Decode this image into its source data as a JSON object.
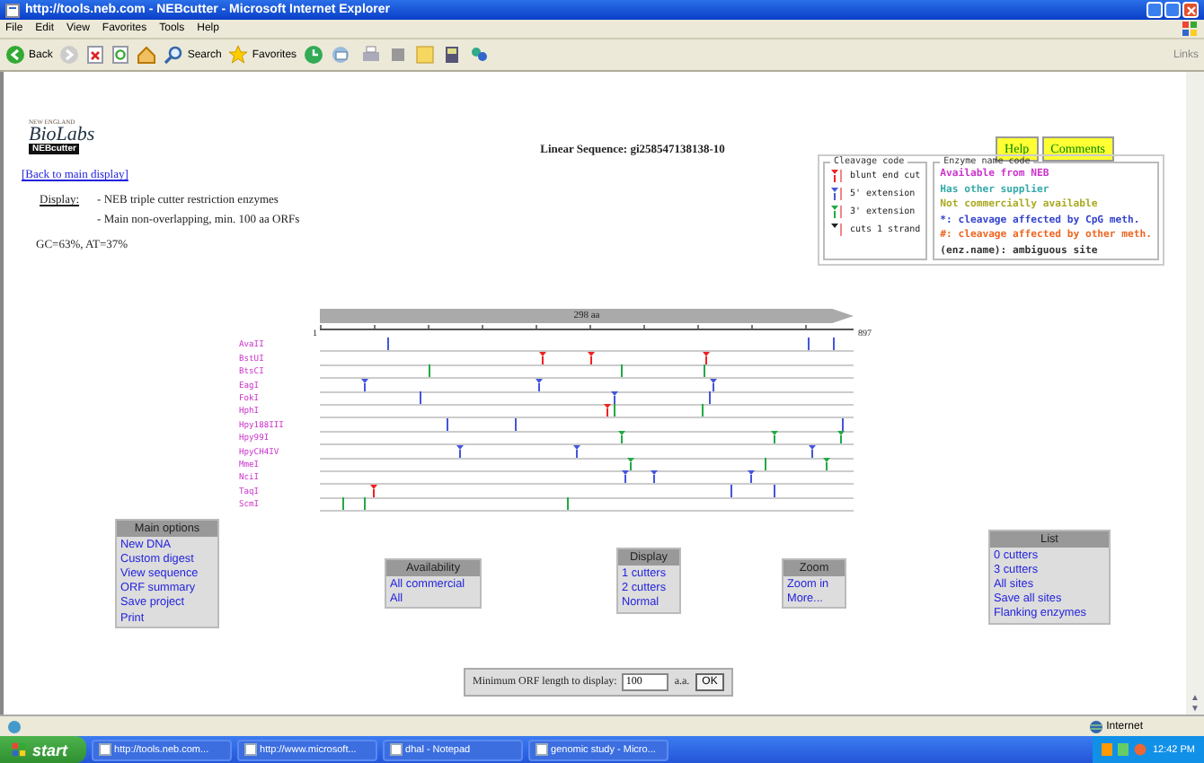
{
  "window": {
    "title": "http://tools.neb.com - NEBcutter - Microsoft Internet Explorer"
  },
  "menu": [
    "File",
    "Edit",
    "View",
    "Favorites",
    "Tools",
    "Help"
  ],
  "toolbar": {
    "back": "Back",
    "search": "Search",
    "favorites": "Favorites",
    "links": "Links"
  },
  "page": {
    "logo": {
      "line1": "NEW ENGLAND",
      "line2": "BioLabs",
      "badge": "NEBcutter"
    },
    "title": "Linear Sequence: gi258547138138-10",
    "buttons": [
      "Help",
      "Comments"
    ],
    "back_link": "[Back to main display]",
    "display_label": "Display:",
    "display_lines": [
      "- NEB triple cutter restriction enzymes",
      "- Main non-overlapping, min. 100 aa ORFs"
    ],
    "gc": "GC=63%, AT=37%",
    "cleavage_code": {
      "title": "Cleavage code",
      "items": [
        {
          "kind": "blunt",
          "label": "blunt end cut"
        },
        {
          "kind": "five",
          "label": "5' extension"
        },
        {
          "kind": "three",
          "label": "3' extension"
        },
        {
          "kind": "strand",
          "label": "cuts 1 strand"
        }
      ]
    },
    "name_code": {
      "title": "Enzyme name code",
      "items": [
        {
          "text": "Available from NEB",
          "color": "#cc33cc"
        },
        {
          "text": "Has other supplier",
          "color": "#33aaaa"
        },
        {
          "text": "Not commercially available",
          "color": "#aaaa22"
        },
        {
          "text": "*: cleavage affected by CpG meth.",
          "color": "#3344cc"
        },
        {
          "text": "#: cleavage affected by other meth.",
          "color": "#ee6622"
        },
        {
          "text": "(enz.name): ambiguous site",
          "color": "#333333"
        }
      ]
    },
    "map": {
      "length": "298 aa",
      "start": "1",
      "end": "897",
      "enzymes": [
        {
          "name": "AvaII",
          "cuts": [
            {
              "kind": "five",
              "strand": false
            },
            {
              "kind": "five",
              "strand": false
            },
            {
              "kind": "five",
              "strand": false
            }
          ]
        },
        {
          "name": "BstUI",
          "cuts": [
            {
              "kind": "blunt",
              "strand": true
            },
            {
              "kind": "blunt",
              "strand": true
            },
            {
              "kind": "blunt",
              "strand": true
            }
          ]
        },
        {
          "name": "BtsCI",
          "cuts": [
            {
              "kind": "three",
              "strand": false
            },
            {
              "kind": "three",
              "strand": false
            },
            {
              "kind": "three",
              "strand": false
            }
          ]
        },
        {
          "name": "EagI",
          "cuts": [
            {
              "kind": "five",
              "strand": true
            },
            {
              "kind": "five",
              "strand": true
            },
            {
              "kind": "five",
              "strand": true
            }
          ]
        },
        {
          "name": "FokI",
          "cuts": [
            {
              "kind": "five",
              "strand": false
            },
            {
              "kind": "five",
              "strand": true
            },
            {
              "kind": "five",
              "strand": false
            }
          ]
        },
        {
          "name": "HphI",
          "cuts": [
            {
              "kind": "blunt",
              "strand": true
            },
            {
              "kind": "three",
              "strand": false
            },
            {
              "kind": "three",
              "strand": false
            }
          ]
        },
        {
          "name": "Hpy188III",
          "cuts": [
            {
              "kind": "five",
              "strand": false
            },
            {
              "kind": "five",
              "strand": false
            },
            {
              "kind": "five",
              "strand": false
            }
          ]
        },
        {
          "name": "Hpy99I",
          "cuts": [
            {
              "kind": "three",
              "strand": true
            },
            {
              "kind": "three",
              "strand": true
            },
            {
              "kind": "three",
              "strand": true
            }
          ]
        },
        {
          "name": "HpyCH4IV",
          "cuts": [
            {
              "kind": "five",
              "strand": true
            },
            {
              "kind": "five",
              "strand": true
            },
            {
              "kind": "five",
              "strand": true
            }
          ]
        },
        {
          "name": "MmeI",
          "cuts": [
            {
              "kind": "three",
              "strand": true
            },
            {
              "kind": "three",
              "strand": false
            },
            {
              "kind": "three",
              "strand": true
            }
          ]
        },
        {
          "name": "NciI",
          "cuts": [
            {
              "kind": "five",
              "strand": true
            },
            {
              "kind": "five",
              "strand": true
            },
            {
              "kind": "five",
              "strand": true
            }
          ]
        },
        {
          "name": "TaqI",
          "cuts": [
            {
              "kind": "blunt",
              "strand": true
            },
            {
              "kind": "five",
              "strand": false
            },
            {
              "kind": "five",
              "strand": false
            }
          ]
        },
        {
          "name": "ScmI",
          "cuts": [
            {
              "kind": "three",
              "strand": false
            },
            {
              "kind": "three",
              "strand": false
            },
            {
              "kind": "three",
              "strand": false
            }
          ]
        }
      ]
    },
    "menus": [
      {
        "title": "Main options",
        "items": [
          "New DNA",
          "Custom digest",
          "View sequence",
          "ORF summary",
          "Save project",
          "Print"
        ]
      },
      {
        "title": "Availability",
        "items": [
          "All commercial",
          "All"
        ]
      },
      {
        "title": "Display",
        "items": [
          "1 cutters",
          "2 cutters",
          "Normal"
        ]
      },
      {
        "title": "Zoom",
        "items": [
          "Zoom in",
          "More..."
        ]
      },
      {
        "title": "List",
        "items": [
          "0 cutters",
          "3 cutters",
          "All sites",
          "Save all sites",
          "Flanking enzymes"
        ]
      }
    ],
    "orf": {
      "label": "Minimum ORF length to display:",
      "value": "100",
      "unit": "a.a.",
      "button": "OK"
    }
  },
  "scrollbar": {
    "up": "▲",
    "down": "▼"
  },
  "status_bar": {
    "zone": "Internet"
  },
  "taskbar": {
    "start": "start",
    "items": [
      "http://tools.neb.com...",
      "http://www.microsoft...",
      "dhal - Notepad",
      "genomic study - Micro..."
    ],
    "clock": "12:42 PM"
  }
}
